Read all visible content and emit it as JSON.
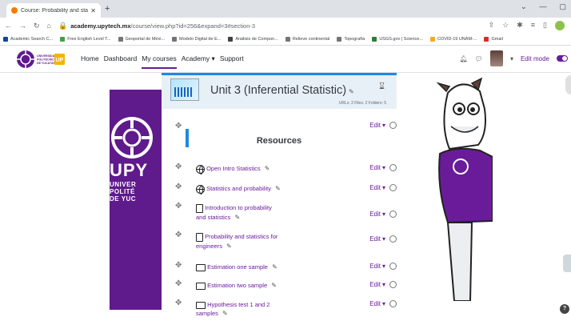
{
  "browser": {
    "tab_title": "Course: Probability and statistics",
    "url_host": "academy.upytech.mx",
    "url_path": "/course/view.php?id=256&expand=3#section-3"
  },
  "bookmarks": [
    {
      "label": "Academic Search C...",
      "color": "#0d47a1"
    },
    {
      "label": "Free English Level T...",
      "color": "#43a047"
    },
    {
      "label": "Geoportal de Méxi...",
      "color": "#757575"
    },
    {
      "label": "Modelo Digital de E...",
      "color": "#757575"
    },
    {
      "label": "Análisis de Compon...",
      "color": "#424242"
    },
    {
      "label": "Relieve continental",
      "color": "#757575"
    },
    {
      "label": "Topografía",
      "color": "#757575"
    },
    {
      "label": "USGS.gov | Science...",
      "color": "#2e7d32"
    },
    {
      "label": "COVID-19 UNAM-...",
      "color": "#f9a825"
    },
    {
      "label": "Gmail",
      "color": "#d32f2f"
    }
  ],
  "site": {
    "logo_text_1": "UNIVERSIDAD",
    "logo_text_2": "POLITÉCNICA",
    "logo_text_3": "DE YUCATÁN",
    "logo_badge": "UP",
    "menu": [
      "Home",
      "Dashboard",
      "My courses",
      "Academy ▾",
      "Support"
    ],
    "edit_mode": "Edit mode"
  },
  "banner": {
    "big": "UPY",
    "line1": "UNIVER",
    "line2": "POLITÉ",
    "line3": "DE YUC"
  },
  "unit": {
    "title": "Unit 3 (Inferential Statistic)",
    "counts": "URLs: 2 Files: 2 Folders: 5"
  },
  "section": {
    "title": "Resources",
    "edit": "Edit"
  },
  "items": [
    {
      "type": "url",
      "label": "Open Intro Statistics",
      "edit": "Edit"
    },
    {
      "type": "url",
      "label": "Statistics and probability",
      "edit": "Edit"
    },
    {
      "type": "file",
      "label_1": "Introduction to probability",
      "label_2": "and statistics",
      "edit": "Edit"
    },
    {
      "type": "file",
      "label_1": "Probability and statistics for",
      "label_2": "engineers",
      "edit": "Edit"
    },
    {
      "type": "folder",
      "label": "Estimation one sample",
      "edit": "Edit"
    },
    {
      "type": "folder",
      "label": "Estimation two sample",
      "edit": "Edit"
    },
    {
      "type": "folder",
      "label_1": "Hypothesis test 1 and 2",
      "label_2": "samples",
      "edit": "Edit"
    }
  ],
  "colors": {
    "brand": "#5f1a8c",
    "accent": "#1e88e5",
    "link": "#6a1b9a"
  }
}
